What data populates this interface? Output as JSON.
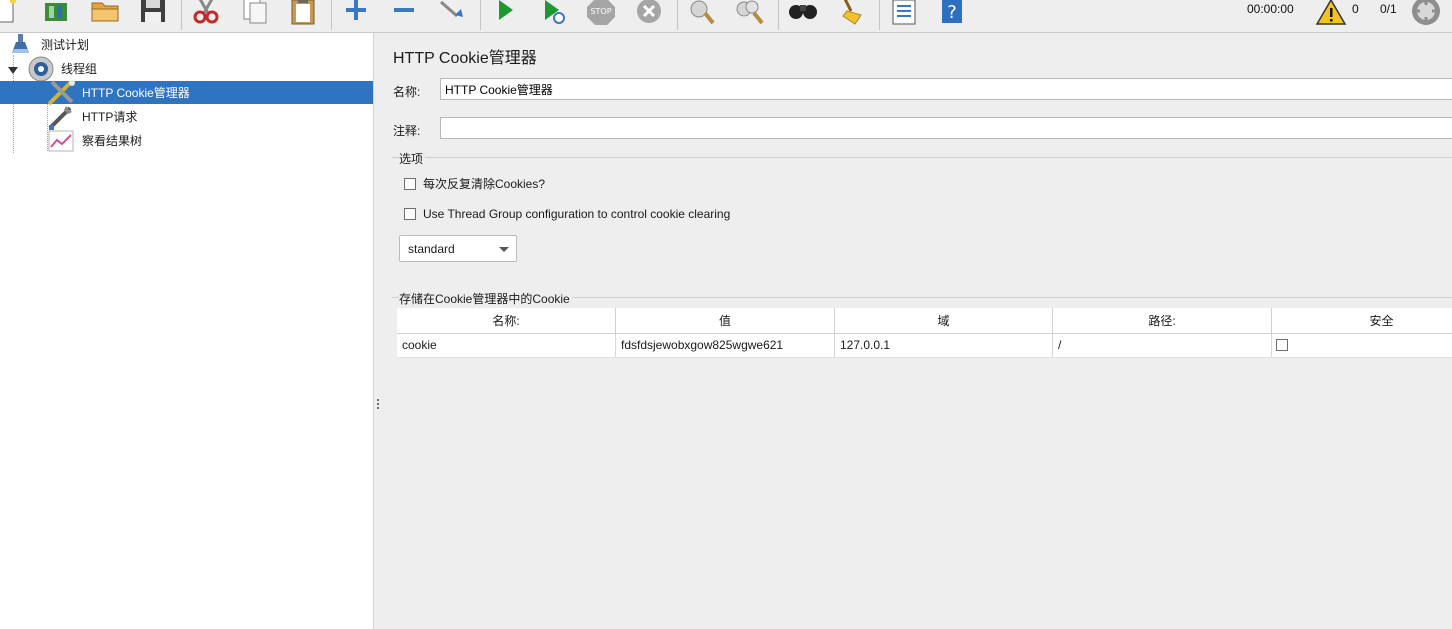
{
  "toolbar": {
    "buttons": [
      {
        "name": "new-icon"
      },
      {
        "name": "templates-icon"
      },
      {
        "name": "open-icon"
      },
      {
        "name": "save-icon"
      },
      {
        "name": "cut-icon"
      },
      {
        "name": "copy-icon"
      },
      {
        "name": "paste-icon"
      },
      {
        "name": "expand-icon"
      },
      {
        "name": "collapse-icon"
      },
      {
        "name": "toggle-icon"
      },
      {
        "name": "start-icon"
      },
      {
        "name": "start-no-pauses-icon"
      },
      {
        "name": "stop-icon"
      },
      {
        "name": "shutdown-icon"
      },
      {
        "name": "clear-icon"
      },
      {
        "name": "clear-all-icon"
      },
      {
        "name": "search-icon"
      },
      {
        "name": "reset-search-icon"
      },
      {
        "name": "function-helper-icon"
      },
      {
        "name": "help-icon"
      }
    ],
    "elapsed_time": "00:00:00",
    "warning_count": "0",
    "active_threads": "0/1"
  },
  "tree": {
    "items": [
      {
        "label": "测试计划",
        "icon": "test-plan-icon"
      },
      {
        "label": "线程组",
        "icon": "thread-group-icon"
      },
      {
        "label": "HTTP Cookie管理器",
        "icon": "cookie-manager-icon",
        "selected": true
      },
      {
        "label": "HTTP请求",
        "icon": "http-request-icon"
      },
      {
        "label": "察看结果树",
        "icon": "results-tree-icon"
      }
    ]
  },
  "panel": {
    "title": "HTTP Cookie管理器",
    "name_label": "名称:",
    "name_value": "HTTP Cookie管理器",
    "comment_label": "注释:",
    "comment_value": "",
    "options_title": "选项",
    "clear_each_iteration_label": "每次反复清除Cookies?",
    "clear_each_iteration_checked": false,
    "thread_group_config_label": "Use Thread Group configuration to control cookie clearing",
    "thread_group_config_checked": false,
    "cookie_policy": "standard",
    "stored_cookies_title": "存储在Cookie管理器中的Cookie",
    "table": {
      "columns": [
        "名称:",
        "值",
        "域",
        "路径:",
        "安全"
      ],
      "rows": [
        {
          "name": "cookie",
          "value": "fdsfdsjewobxgow825wgwe621",
          "domain": "127.0.0.1",
          "path": "/",
          "secure": false
        }
      ]
    }
  }
}
